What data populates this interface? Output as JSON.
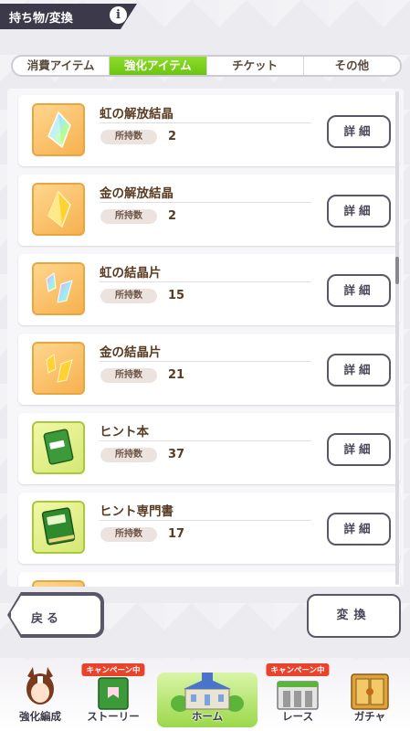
{
  "header": {
    "title": "持ち物/変換",
    "info_icon": "i"
  },
  "tabs": [
    {
      "label": "消費アイテム",
      "active": false
    },
    {
      "label": "強化アイテム",
      "active": true
    },
    {
      "label": "チケット",
      "active": false
    },
    {
      "label": "その他",
      "active": false
    }
  ],
  "items": [
    {
      "name": "虹の解放結晶",
      "owned_label": "所持数",
      "count": "2",
      "detail_label": "詳細",
      "icon": "rainbow-crystal-icon"
    },
    {
      "name": "金の解放結晶",
      "owned_label": "所持数",
      "count": "2",
      "detail_label": "詳細",
      "icon": "gold-crystal-icon"
    },
    {
      "name": "虹の結晶片",
      "owned_label": "所持数",
      "count": "15",
      "detail_label": "詳細",
      "icon": "rainbow-shard-icon"
    },
    {
      "name": "金の結晶片",
      "owned_label": "所持数",
      "count": "21",
      "detail_label": "詳細",
      "icon": "gold-shard-icon"
    },
    {
      "name": "ヒント本",
      "owned_label": "所持数",
      "count": "37",
      "detail_label": "詳細",
      "icon": "hint-book-icon"
    },
    {
      "name": "ヒント専門書",
      "owned_label": "所持数",
      "count": "17",
      "detail_label": "詳細",
      "icon": "hint-specialist-book-icon"
    }
  ],
  "buttons": {
    "back_label": "戻る",
    "exchange_label": "変換"
  },
  "footer_nav": [
    {
      "label": "強化編成",
      "badge": "",
      "icon": "horse-girl-icon"
    },
    {
      "label": "ストーリー",
      "badge": "キャンペーン中",
      "icon": "story-book-icon"
    },
    {
      "label": "ホーム",
      "badge": "",
      "icon": "home-building-icon"
    },
    {
      "label": "レース",
      "badge": "キャンペーン中",
      "icon": "race-gate-icon"
    },
    {
      "label": "ガチャ",
      "badge": "",
      "icon": "gacha-door-icon"
    }
  ],
  "colors": {
    "accent_green": "#7cd01d",
    "header_dark": "#3c3a4a",
    "badge_red": "#e9432b",
    "text_brown": "#5a3c22"
  }
}
